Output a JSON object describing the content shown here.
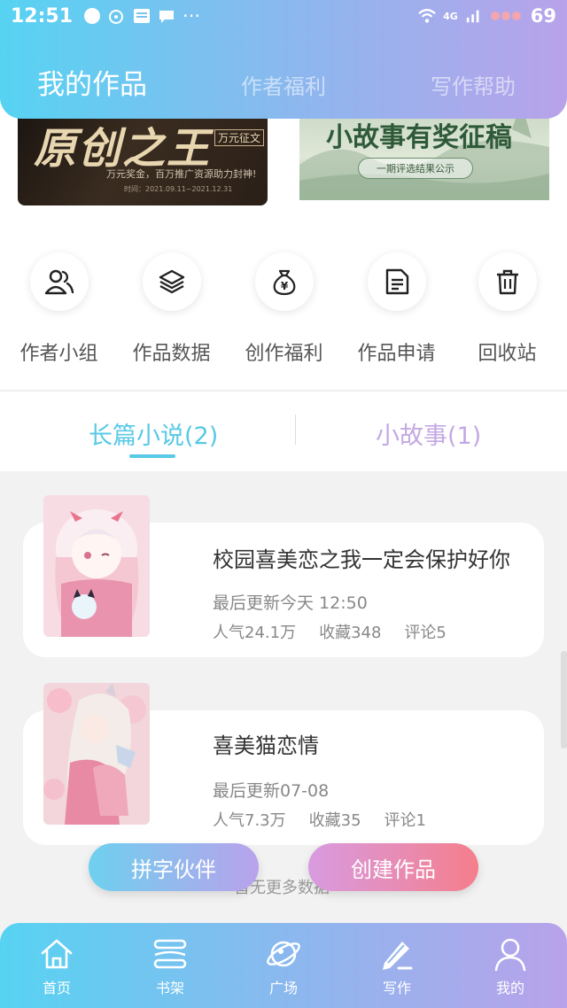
{
  "status_bar": {
    "time": "12:51",
    "news_label": "NEWS",
    "more": "···",
    "network": "4G",
    "battery": "69"
  },
  "header": {
    "tabs": [
      {
        "label": "我的作品",
        "active": true
      },
      {
        "label": "作者福利",
        "active": false
      },
      {
        "label": "写作帮助",
        "active": false
      }
    ]
  },
  "banners": {
    "left": {
      "title": "原创之王",
      "tag": "万元征文",
      "subtitle": "万元奖金，百万推广资源助力封神!",
      "date": "时间：2021.09.11~2021.12.31"
    },
    "right": {
      "title": "小故事有奖征稿",
      "pill": "一期评选结果公示"
    }
  },
  "quick_actions": [
    {
      "label": "作者小组",
      "icon": "users-icon"
    },
    {
      "label": "作品数据",
      "icon": "layers-icon"
    },
    {
      "label": "创作福利",
      "icon": "money-bag-icon"
    },
    {
      "label": "作品申请",
      "icon": "document-icon"
    },
    {
      "label": "回收站",
      "icon": "trash-icon"
    }
  ],
  "subtabs": [
    {
      "label": "长篇小说(2)",
      "active": true
    },
    {
      "label": "小故事(1)",
      "active": false
    }
  ],
  "works": [
    {
      "title": "校园喜美恋之我一定会保护好你",
      "updated": "最后更新今天 12:50",
      "popularity": "人气24.1万",
      "favorites": "收藏348",
      "comments": "评论5"
    },
    {
      "title": "喜美猫恋情",
      "updated": "最后更新07-08",
      "popularity": "人气7.3万",
      "favorites": "收藏35",
      "comments": "评论1"
    }
  ],
  "no_more": "暂无更多数据",
  "buttons": {
    "partner": "拼字伙伴",
    "create": "创建作品"
  },
  "bottom_nav": [
    {
      "label": "首页",
      "icon": "home-icon"
    },
    {
      "label": "书架",
      "icon": "bookshelf-icon"
    },
    {
      "label": "广场",
      "icon": "planet-icon"
    },
    {
      "label": "写作",
      "icon": "pen-icon",
      "active": true
    },
    {
      "label": "我的",
      "icon": "user-icon"
    }
  ],
  "colors": {
    "accent_cyan": "#58c9e6",
    "accent_purple": "#c3a8e4",
    "gradient_start": "#57d3f2",
    "gradient_end": "#b8a2ea",
    "create_button": "#f57e8c"
  }
}
